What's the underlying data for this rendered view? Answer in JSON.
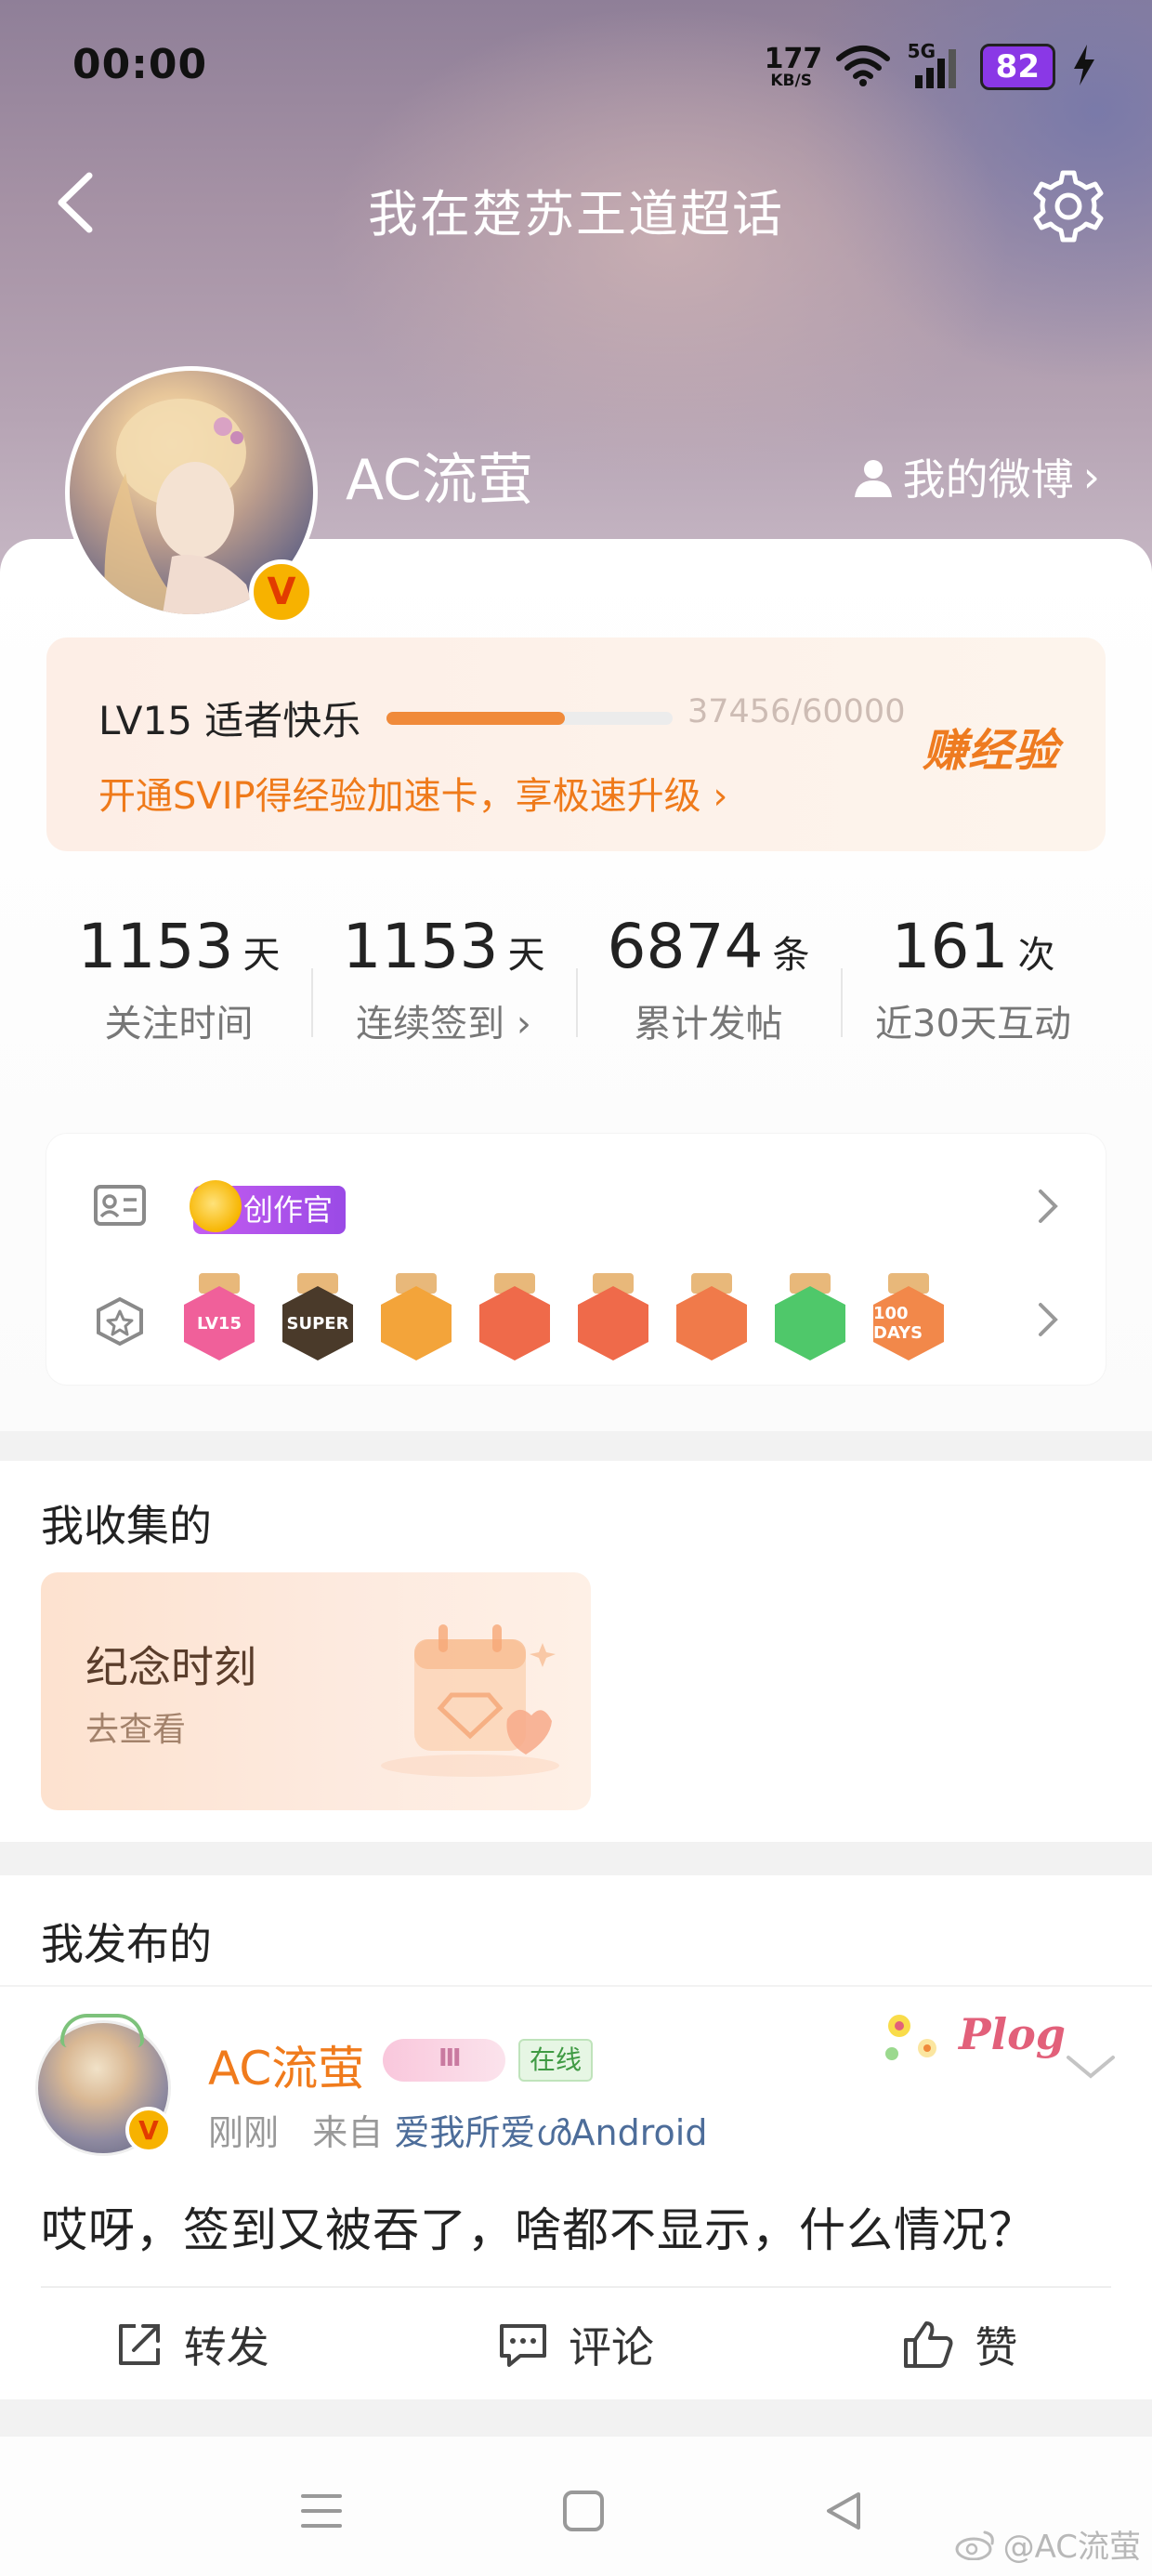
{
  "status_bar": {
    "time": "00:00",
    "net_speed_value": "177",
    "net_speed_unit": "KB/S",
    "signal_label": "5G",
    "battery": "82"
  },
  "nav": {
    "title": "我在楚苏王道超话"
  },
  "profile": {
    "username": "AC流萤",
    "verified_badge": "V",
    "my_weibo_label": "我的微博",
    "my_weibo_chevron": "›"
  },
  "level": {
    "label": "LV15 适者快乐",
    "progress_text": "37456/60000",
    "progress_fraction": 0.624,
    "svip_link": "开通SVIP得经验加速卡，享极速升级 ›",
    "earn_exp": "赚经验"
  },
  "stats": [
    {
      "value": "1153",
      "unit": "天",
      "label": "关注时间"
    },
    {
      "value": "1153",
      "unit": "天",
      "label": "连续签到 ›"
    },
    {
      "value": "6874",
      "unit": "条",
      "label": "累计发帖"
    },
    {
      "value": "161",
      "unit": "次",
      "label": "近30天互动"
    }
  ],
  "badges": {
    "creator_tag": "创作官",
    "medals": [
      {
        "text": "LV15",
        "color": "#f0609a"
      },
      {
        "text": "SUPER",
        "color": "#4a3a2a"
      },
      {
        "text": "",
        "color": "#f3a43a"
      },
      {
        "text": "",
        "color": "#ef6a4a"
      },
      {
        "text": "",
        "color": "#ef6a4a"
      },
      {
        "text": "",
        "color": "#f07a4a"
      },
      {
        "text": "",
        "color": "#4fc86a"
      },
      {
        "text": "100 DAYS",
        "color": "#f2884a"
      }
    ]
  },
  "collected": {
    "section_title": "我收集的",
    "card_title": "纪念时刻",
    "card_sub": "去查看"
  },
  "posted": {
    "section_title": "我发布的",
    "post": {
      "author": "AC流萤",
      "level_mark": "Ⅲ",
      "online_tag": "在线",
      "decoration_text": "Plog",
      "time": "刚刚",
      "from_prefix": "来自",
      "source": "爱我所爱ൾAndroid",
      "content": "哎呀，签到又被吞了，啥都不显示，什么情况？"
    },
    "actions": {
      "repost": "转发",
      "comment": "评论",
      "like": "赞"
    }
  },
  "watermark": "@AC流萤",
  "colors": {
    "accent_orange": "#f07b1c",
    "link_blue": "#4d6d9a",
    "battery_purple": "#8a38e6",
    "verified_gold": "#f7b200"
  }
}
